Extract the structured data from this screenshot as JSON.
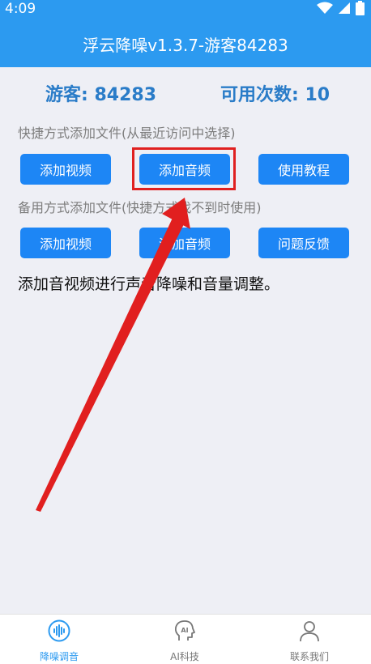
{
  "status": {
    "time": "4:09",
    "icons": [
      "wifi-icon",
      "signal-icon",
      "battery-icon"
    ]
  },
  "header": {
    "title": "浮云降噪v1.3.7-游客84283"
  },
  "stats": {
    "guest": "游客: 84283",
    "uses": "可用次数: 10"
  },
  "quick_section": {
    "label": "快捷方式添加文件(从最近访问中选择)",
    "buttons": [
      "添加视频",
      "添加音频",
      "使用教程"
    ]
  },
  "backup_section": {
    "label": "备用方式添加文件(快捷方式找不到时使用)",
    "buttons": [
      "添加视频",
      "添加音频",
      "问题反馈"
    ]
  },
  "description": "添加音视频进行声音降噪和音量调整。",
  "bottom_nav": {
    "items": [
      {
        "label": "降噪调音",
        "icon": "waveform-icon",
        "active": true
      },
      {
        "label": "AI科技",
        "icon": "ai-head-icon",
        "active": false
      },
      {
        "label": "联系我们",
        "icon": "person-icon",
        "active": false
      }
    ]
  },
  "colors": {
    "primary": "#2c9af0",
    "button": "#1d86f5",
    "stat_text": "#2a7cc8",
    "highlight": "#e02020",
    "background": "#eeeff5"
  }
}
